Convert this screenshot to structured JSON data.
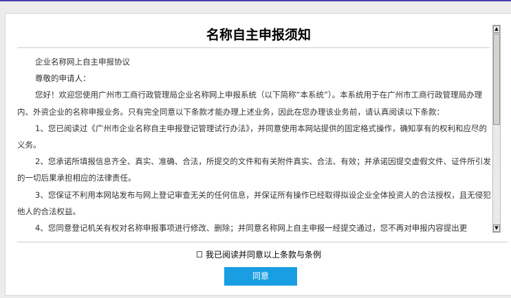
{
  "title": "名称自主申报须知",
  "paragraphs": [
    "企业名称网上自主申报协议",
    "尊敬的申请人：",
    "您好！欢迎您使用广州市工商行政管理局企业名称网上申报系统（以下简称“本系统”）。本系统用于在广州市工商行政管理局办理 内、外资企业的名称申报业务。只有完全同意以下条款才能办理上述业务，因此在您办理该业务前，请认真阅读以下条款：",
    "1、您已阅读过《广州市企业名称自主申报登记管理试行办法》，并同意使用本网站提供的固定格式操作，确知享有的权利和应尽的义务。",
    "2、您承诺所填报信息齐全、真实、准确、合法，所提交的文件和有关附件真实、合法、有效；并承诺因提交虚假文件、证件所引发的一切后果承担相应的法律责任。",
    "3、您保证不利用本网站发布与网上登记审查无关的任何信息，并保证所有操作已经取得拟设企业全体投资人的合法授权，且无侵犯他人的合法权益。",
    "4、您同意登记机关有权对名称申报事项进行修改、删除；并同意名称网上自主申报一经提交通过，您不再对申报内容提出更"
  ],
  "agree_checkbox": {
    "label": "我已阅读并同意以上条款与条例",
    "checked": false
  },
  "agree_button": "同意",
  "colors": {
    "button": "#1a9ee3",
    "top_line": "#4a3fb0"
  }
}
